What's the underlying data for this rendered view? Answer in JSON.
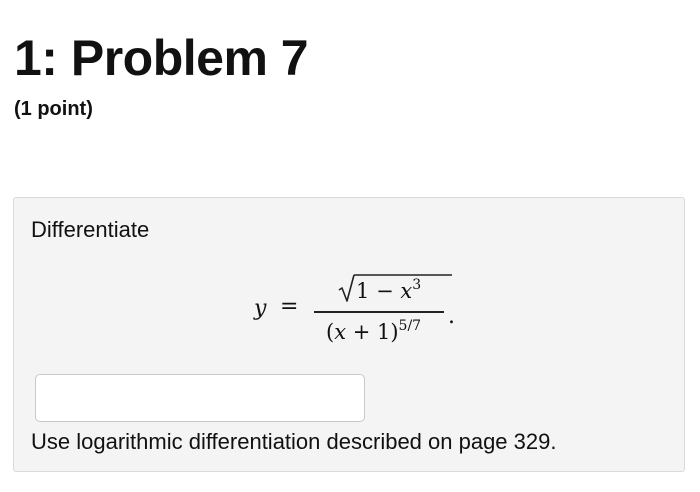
{
  "header": {
    "title": "1: Problem 7",
    "points": "(1 point)"
  },
  "problem": {
    "instruction": "Differentiate",
    "equation": {
      "lhs": "y",
      "equals": "=",
      "num_constant": "1",
      "num_minus": "−",
      "num_variable": "x",
      "num_exponent": "3",
      "den_open": "(",
      "den_variable": "x",
      "den_plus": " + 1)",
      "den_exponent": "5/7",
      "period": "."
    },
    "answer": {
      "value": "",
      "placeholder": ""
    },
    "hint": "Use logarithmic differentiation described on page 329."
  }
}
